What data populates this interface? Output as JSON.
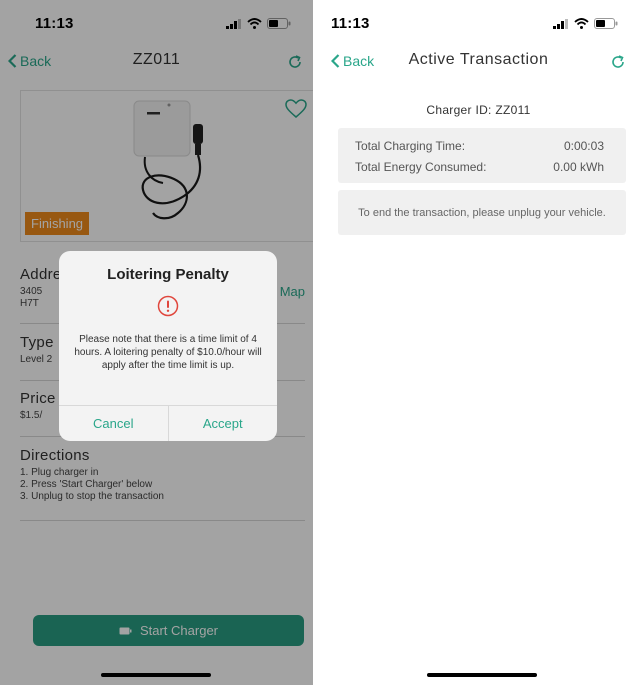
{
  "left": {
    "status": {
      "time": "11:13"
    },
    "nav": {
      "back_label": "Back",
      "title": "ZZ011"
    },
    "badge": "Finishing",
    "address": {
      "title": "Address",
      "line1": "3405",
      "line2": "H7T",
      "map_label": "Map"
    },
    "type": {
      "title": "Type",
      "line1": "Level 2"
    },
    "price": {
      "title": "Price",
      "line1": "$1.5/"
    },
    "directions": {
      "title": "Directions",
      "steps": [
        "1. Plug charger in",
        "2. Press 'Start Charger' below",
        "3. Unplug to stop the transaction"
      ]
    },
    "start_button": "Start Charger",
    "dialog": {
      "title": "Loitering Penalty",
      "message": "Please note that there is a time limit of 4 hours. A loitering penalty of $10.0/hour will apply after the time limit is up.",
      "cancel": "Cancel",
      "accept": "Accept"
    }
  },
  "right": {
    "status": {
      "time": "11:13"
    },
    "nav": {
      "back_label": "Back",
      "title": "Active Transaction"
    },
    "charger_id": "Charger ID: ZZ011",
    "stats": [
      {
        "label": "Total Charging Time:",
        "value": "0:00:03"
      },
      {
        "label": "Total Energy Consumed:",
        "value": "0.00 kWh"
      }
    ],
    "note": "To end the transaction, please unplug your vehicle."
  },
  "colors": {
    "accent": "#2aa68a",
    "button": "#2a9d82",
    "badge": "#ee8a1c",
    "alert": "#e0463c"
  }
}
